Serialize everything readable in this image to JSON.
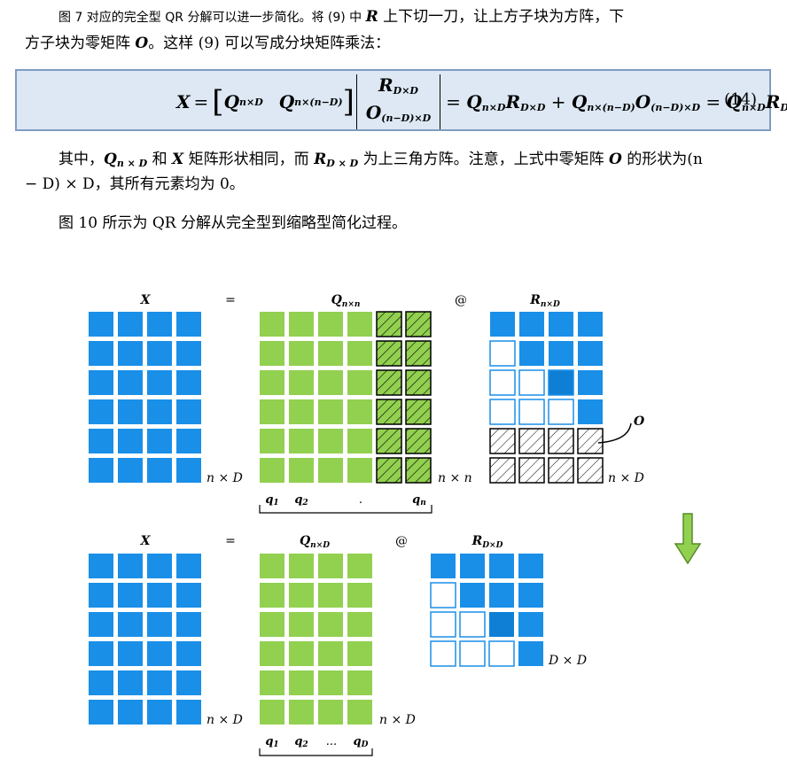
{
  "paragraph1": {
    "line1_prefix": "图 7 对应的完全型 QR 分解可以进一步简化。将 (9) 中 ",
    "R": "R",
    "line1_suffix": " 上下切一刀，让上方子块为方阵，下",
    "line2_prefix": "方子块为零矩阵 ",
    "O": "O",
    "line2_suffix": "。这样 (9) 可以写成分块矩阵乘法："
  },
  "equation": {
    "lhs": "X",
    "eq": "=",
    "q_nd": "Q",
    "q_nd_sub": "n×D",
    "q_rest": "Q",
    "q_rest_sub": "n×(n−D)",
    "r_dd": "R",
    "r_dd_sub": "D×D",
    "o_block": "O",
    "o_block_sub": "(n−D)×D",
    "expand": "= Q R + Q O = Q R",
    "number": "(14)"
  },
  "paragraph2": {
    "t1": "其中，",
    "Q": "Q",
    "Qsub": "n × D",
    "t2": " 和 ",
    "X": "X",
    "t3": " 矩阵形状相同，而 ",
    "R": "R",
    "Rsub": "D × D",
    "t4": " 为上三角方阵。注意，上式中零矩阵 ",
    "O": "O",
    "t5": " 的形状为(n",
    "line2": "− D) × D，其所有元素均为 0。"
  },
  "paragraph3": "图 10 所示为 QR 分解从完全型到缩略型简化过程。",
  "figure": {
    "top": {
      "x_label": "X",
      "eq": "=",
      "q_label": "Q",
      "q_sub": "n×n",
      "at": "@",
      "r_label": "R",
      "r_sub": "n×D",
      "x_dim": "n × D",
      "q_dim": "n × n",
      "r_dim": "n × D",
      "o_label": "O",
      "q_cols": [
        "q1",
        "q2",
        "...",
        "qn"
      ]
    },
    "bottom": {
      "x_label": "X",
      "eq": "=",
      "q_label": "Q",
      "q_sub": "n×D",
      "at": "@",
      "r_label": "R",
      "r_sub": "D×D",
      "x_dim": "n × D",
      "q_dim": "n × D",
      "r_dim": "D × D",
      "q_cols": [
        "q1",
        "q2",
        "...",
        "qD"
      ]
    },
    "colors": {
      "blue": "#1a8fe8",
      "green": "#92d050",
      "hatch": "#000000",
      "arrow": "#92d050"
    }
  }
}
